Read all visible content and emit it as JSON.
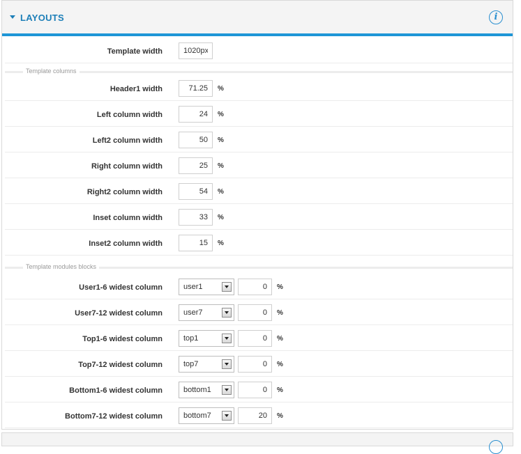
{
  "panel": {
    "title": "LAYOUTS",
    "info_icon_glyph": "i"
  },
  "template_width": {
    "label": "Template width",
    "value": "1020px"
  },
  "sections": {
    "columns": "Template columns",
    "modules": "Template modules blocks"
  },
  "columns": [
    {
      "label": "Header1 width",
      "value": "71.25",
      "unit": "%"
    },
    {
      "label": "Left column width",
      "value": "24",
      "unit": "%"
    },
    {
      "label": "Left2 column width",
      "value": "50",
      "unit": "%"
    },
    {
      "label": "Right column width",
      "value": "25",
      "unit": "%"
    },
    {
      "label": "Right2 column width",
      "value": "54",
      "unit": "%"
    },
    {
      "label": "Inset column width",
      "value": "33",
      "unit": "%"
    },
    {
      "label": "Inset2 column width",
      "value": "15",
      "unit": "%"
    }
  ],
  "modules": [
    {
      "label": "User1-6 widest column",
      "selected": "user1",
      "value": "0",
      "unit": "%"
    },
    {
      "label": "User7-12 widest column",
      "selected": "user7",
      "value": "0",
      "unit": "%"
    },
    {
      "label": "Top1-6 widest column",
      "selected": "top1",
      "value": "0",
      "unit": "%"
    },
    {
      "label": "Top7-12 widest column",
      "selected": "top7",
      "value": "0",
      "unit": "%"
    },
    {
      "label": "Bottom1-6 widest column",
      "selected": "bottom1",
      "value": "0",
      "unit": "%"
    },
    {
      "label": "Bottom7-12 widest column",
      "selected": "bottom7",
      "value": "20",
      "unit": "%"
    }
  ],
  "colors": {
    "accent": "#1e96d6",
    "title": "#1d7fb8"
  }
}
